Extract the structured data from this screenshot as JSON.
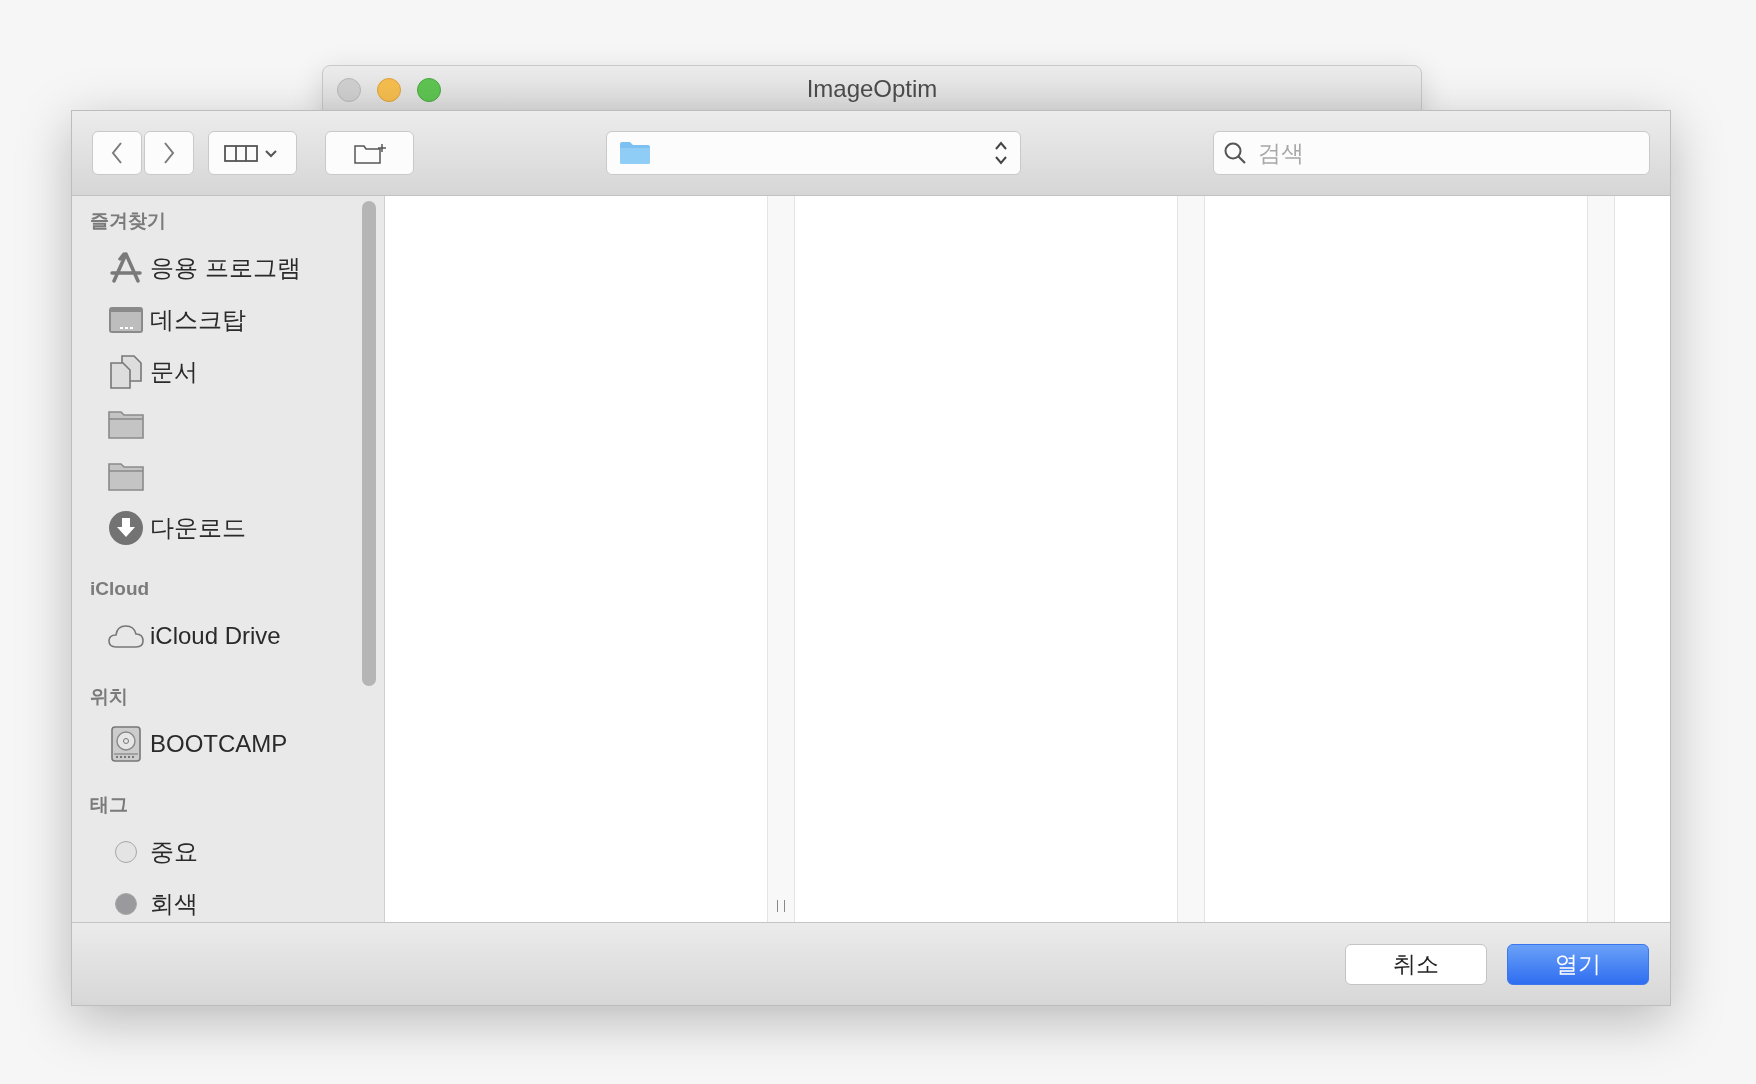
{
  "window": {
    "title": "ImageOptim"
  },
  "toolbar": {
    "search": {
      "placeholder": "검색"
    }
  },
  "sidebar": {
    "sections": [
      {
        "header": "즐겨찾기",
        "items": [
          {
            "kind": "apps",
            "label": "응용 프로그램"
          },
          {
            "kind": "desktop",
            "label": "데스크탑"
          },
          {
            "kind": "documents",
            "label": "문서"
          },
          {
            "kind": "folder"
          },
          {
            "kind": "folder"
          },
          {
            "kind": "downloads",
            "label": "다운로드"
          }
        ]
      },
      {
        "header": "iCloud",
        "items": [
          {
            "kind": "cloud",
            "label": "iCloud Drive"
          }
        ]
      },
      {
        "header": "위치",
        "items": [
          {
            "kind": "disk",
            "label": "BOOTCAMP"
          }
        ]
      },
      {
        "header": "태그",
        "items": [
          {
            "kind": "tag",
            "label": "중요",
            "color": "#e4e4e4"
          },
          {
            "kind": "tag",
            "label": "회색",
            "color": "#9a9a9e"
          }
        ]
      }
    ]
  },
  "buttons": [
    {
      "kind": "cancel",
      "label": "취소"
    },
    {
      "kind": "default",
      "label": "열기"
    }
  ]
}
